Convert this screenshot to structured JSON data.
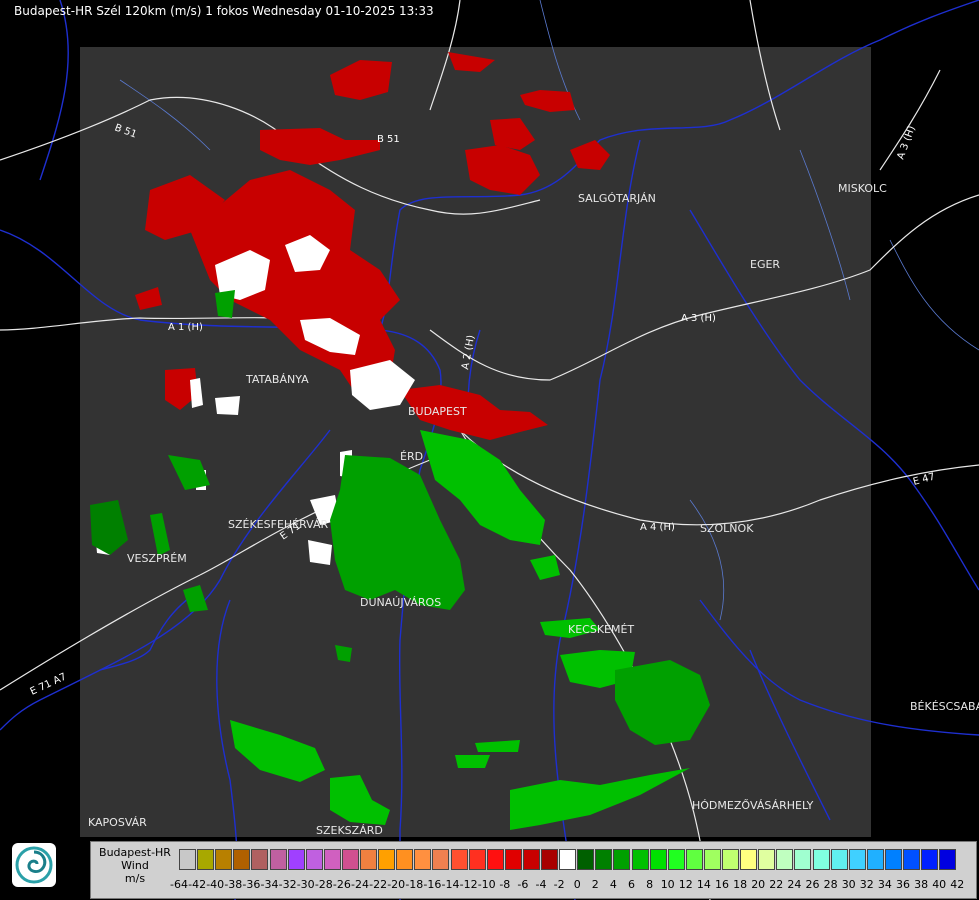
{
  "header": {
    "title": "Budapest-HR Szél 120km (m/s) 1 fokos Wednesday 01-10-2025 13:33"
  },
  "cities": [
    "SALGÓTARJÁN",
    "MISKOLC",
    "EGER",
    "TATABÁNYA",
    "BUDAPEST",
    "ÉRD",
    "SZÉKESFEHÉRVÁR",
    "VESZPRÉM",
    "DUNAÚJVÁROS",
    "KECSKEMÉT",
    "SZOLNOK",
    "BÉKÉSCSABA",
    "HÓDMEZŐVÁSÁRHELY",
    "KAPOSVÁR",
    "SZEKSZÁRD"
  ],
  "roads": [
    "B 51",
    "B 51",
    "A 1 (H)",
    "A 2 (H)",
    "A 3 (H)",
    "A 3 (H)",
    "A 4 (H)",
    "E 71",
    "E 47",
    "E 71 A7"
  ],
  "legend": {
    "title": [
      "Budapest-HR",
      "Wind",
      "m/s"
    ],
    "ticks": [
      "-64",
      "-42",
      "-40",
      "-38",
      "-36",
      "-34",
      "-32",
      "-30",
      "-28",
      "-26",
      "-24",
      "-22",
      "-20",
      "-18",
      "-16",
      "-14",
      "-12",
      "-10",
      "-8",
      "-6",
      "-4",
      "-2",
      "0",
      "2",
      "4",
      "6",
      "8",
      "10",
      "12",
      "14",
      "16",
      "18",
      "20",
      "22",
      "24",
      "26",
      "28",
      "30",
      "32",
      "34",
      "36",
      "38",
      "40",
      "42"
    ],
    "colors": [
      "#c8c8c8",
      "#a8a800",
      "#b88000",
      "#b06000",
      "#b06060",
      "#c060a0",
      "#a040ff",
      "#c060e0",
      "#d060c0",
      "#d05090",
      "#f08040",
      "#ffa000",
      "#ff9020",
      "#ff9040",
      "#f08050",
      "#ff5030",
      "#ff3020",
      "#ff1010",
      "#e00000",
      "#c80000",
      "#a80000",
      "#ffffff",
      "#006000",
      "#008000",
      "#00a000",
      "#00c000",
      "#00e000",
      "#20ff20",
      "#60ff40",
      "#a0ff60",
      "#c0ff70",
      "#ffff80",
      "#e0ffa0",
      "#c0ffc0",
      "#a0ffd0",
      "#80ffe0",
      "#60f0f0",
      "#40d0ff",
      "#20b0ff",
      "#0080ff",
      "#0050ff",
      "#0020ff",
      "#0000e0"
    ]
  }
}
